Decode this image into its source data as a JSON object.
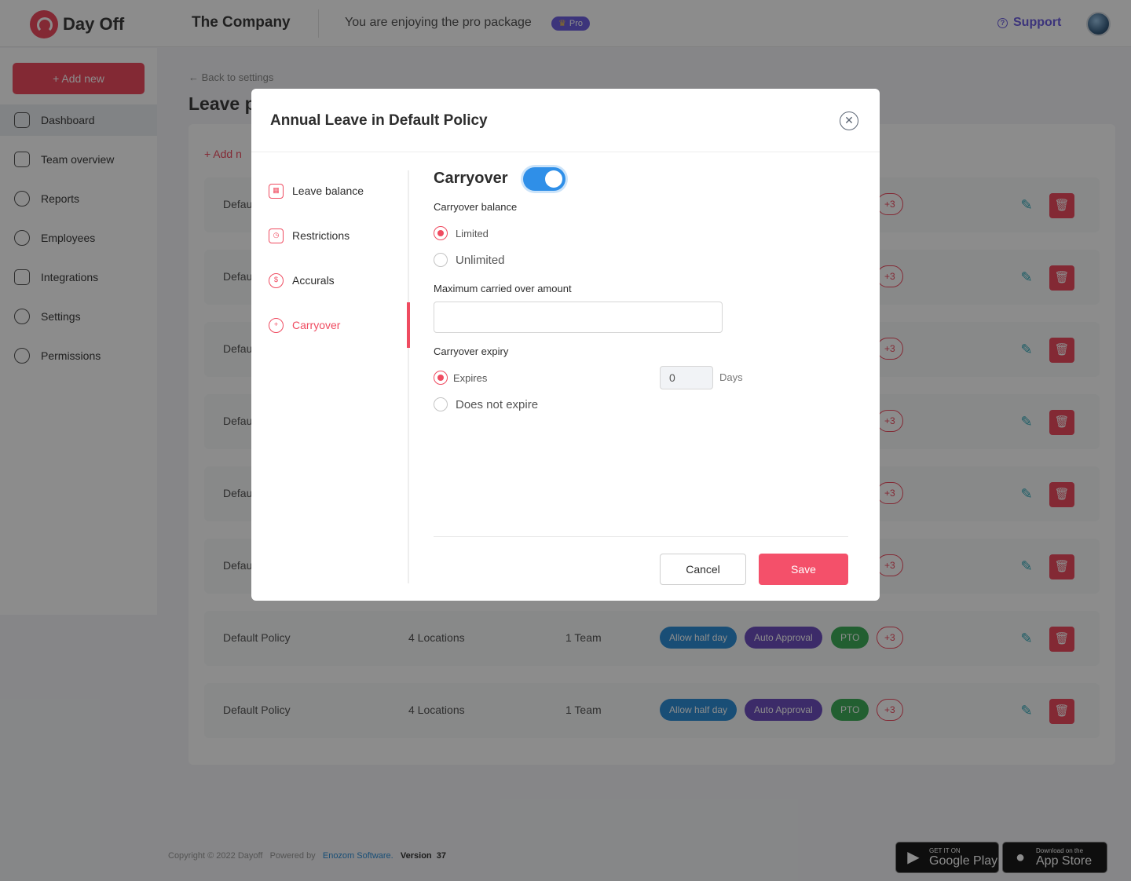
{
  "header": {
    "logo_text": "Day Off",
    "company": "The Company",
    "package_text": "You are enjoying the pro package",
    "pro_badge": "Pro",
    "support_label": "Support"
  },
  "sidebar": {
    "add_new": "Add new",
    "items": [
      {
        "label": "Dashboard",
        "icon": "home-icon"
      },
      {
        "label": "Team overview",
        "icon": "calendar-icon"
      },
      {
        "label": "Reports",
        "icon": "pie-chart-icon"
      },
      {
        "label": "Employees",
        "icon": "user-icon"
      },
      {
        "label": "Integrations",
        "icon": "plug-icon"
      },
      {
        "label": "Settings",
        "icon": "gear-icon"
      },
      {
        "label": "Permissions",
        "icon": "shield-icon"
      }
    ]
  },
  "page": {
    "back_link": "Back to settings",
    "title": "Leave p",
    "add_policy": "Add n",
    "rows": [
      {
        "policy": "Defau"
      },
      {
        "policy": "Defau"
      },
      {
        "policy": "Defau"
      },
      {
        "policy": "Defau"
      },
      {
        "policy": "Defau"
      },
      {
        "policy": "Defau"
      },
      {
        "policy": "Default Policy",
        "locations": "4 Locations",
        "teams": "1 Team",
        "chips": [
          "Allow half day",
          "Auto Approval",
          "PTO"
        ],
        "more": "+3"
      },
      {
        "policy": "Default Policy",
        "locations": "4 Locations",
        "teams": "1 Team",
        "chips": [
          "Allow half day",
          "Auto Approval",
          "PTO"
        ],
        "more": "+3"
      }
    ],
    "more_badge": "+3"
  },
  "footer": {
    "copyright": "Copyright © 2022 Dayoff",
    "powered_by": "Powered by",
    "company_link": "Enozom Software.",
    "version_label": "Version",
    "version": "37",
    "google_play_small": "GET IT ON",
    "google_play_big": "Google Play",
    "app_store_small": "Download on the",
    "app_store_big": "App Store"
  },
  "modal": {
    "title": "Annual Leave in Default Policy",
    "tabs": [
      {
        "label": "Leave balance",
        "icon": "calendar-icon"
      },
      {
        "label": "Restrictions",
        "icon": "calendar-clock-icon"
      },
      {
        "label": "Accurals",
        "icon": "dollar-refresh-icon"
      },
      {
        "label": "Carryover",
        "icon": "refresh-plus-icon",
        "active": true
      }
    ],
    "section_title": "Carryover",
    "toggle_on": true,
    "carryover_balance_label": "Carryover balance",
    "balance_options": [
      "Limited",
      "Unlimited"
    ],
    "balance_selected": "Limited",
    "max_amount_label": "Maximum carried over amount",
    "max_amount_value": "",
    "expiry_label": "Carryover expiry",
    "expiry_options": [
      "Expires",
      "Does not expire"
    ],
    "expiry_selected": "Expires",
    "days_value": "0",
    "days_label": "Days",
    "cancel_label": "Cancel",
    "save_label": "Save"
  }
}
